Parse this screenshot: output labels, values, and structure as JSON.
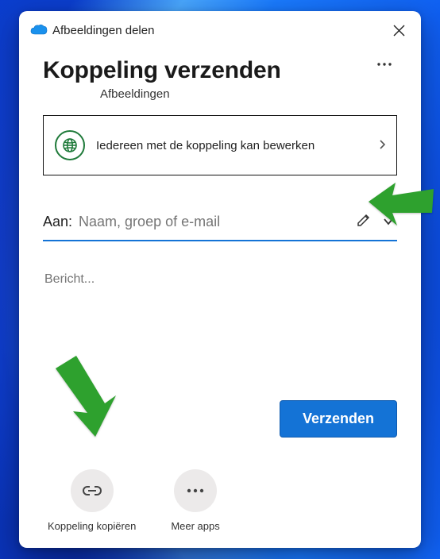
{
  "titlebar": {
    "app_title": "Afbeeldingen delen"
  },
  "header": {
    "title": "Koppeling verzenden",
    "subtitle": "Afbeeldingen"
  },
  "permission": {
    "text": "Iedereen met de koppeling kan bewerken"
  },
  "to": {
    "label": "Aan:",
    "placeholder": "Naam, groep of e-mail"
  },
  "message": {
    "placeholder": "Bericht..."
  },
  "buttons": {
    "send": "Verzenden"
  },
  "actions": {
    "copy_link": "Koppeling kopiëren",
    "more_apps": "Meer apps"
  },
  "colors": {
    "accent": "#1473d6",
    "annotation": "#2ea12e"
  }
}
